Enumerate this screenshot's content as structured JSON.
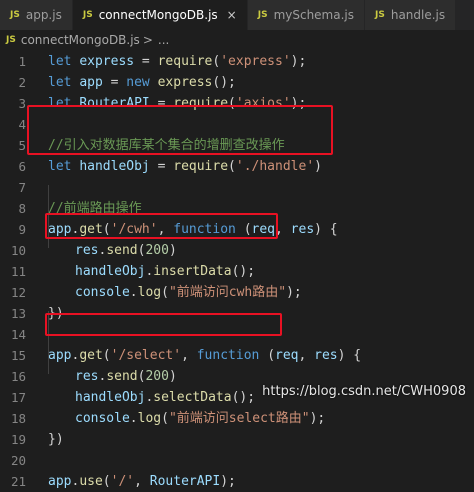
{
  "tabs": [
    {
      "icon": "JS",
      "label": "app.js",
      "active": false
    },
    {
      "icon": "JS",
      "label": "connectMongoDB.js",
      "active": true
    },
    {
      "icon": "JS",
      "label": "mySchema.js",
      "active": false
    },
    {
      "icon": "JS",
      "label": "handle.js",
      "active": false
    }
  ],
  "tab_close_glyph": "×",
  "breadcrumb": {
    "icon": "JS",
    "file": "connectMongoDB.js",
    "separator": ">",
    "more": "..."
  },
  "lines": [
    {
      "n": "1",
      "parts": [
        {
          "t": "let ",
          "c": "kw"
        },
        {
          "t": "express",
          "c": "var"
        },
        {
          "t": " = ",
          "c": "p"
        },
        {
          "t": "require",
          "c": "fn"
        },
        {
          "t": "(",
          "c": "p"
        },
        {
          "t": "'express'",
          "c": "str"
        },
        {
          "t": ");",
          "c": "p"
        }
      ]
    },
    {
      "n": "2",
      "parts": [
        {
          "t": "let ",
          "c": "kw"
        },
        {
          "t": "app",
          "c": "var"
        },
        {
          "t": " = ",
          "c": "p"
        },
        {
          "t": "new ",
          "c": "kw"
        },
        {
          "t": "express",
          "c": "fn"
        },
        {
          "t": "();",
          "c": "p"
        }
      ]
    },
    {
      "n": "3",
      "parts": [
        {
          "t": "let ",
          "c": "kw"
        },
        {
          "t": "RouterAPI",
          "c": "var"
        },
        {
          "t": " = ",
          "c": "p"
        },
        {
          "t": "require",
          "c": "fn"
        },
        {
          "t": "(",
          "c": "p"
        },
        {
          "t": "'axios'",
          "c": "str"
        },
        {
          "t": ");",
          "c": "p"
        }
      ]
    },
    {
      "n": "4",
      "parts": []
    },
    {
      "n": "5",
      "parts": [
        {
          "t": "//引入对数据库某个集合的增删查改操作",
          "c": "cmt"
        }
      ]
    },
    {
      "n": "6",
      "parts": [
        {
          "t": "let ",
          "c": "kw"
        },
        {
          "t": "handleObj",
          "c": "var"
        },
        {
          "t": " = ",
          "c": "p"
        },
        {
          "t": "require",
          "c": "fn"
        },
        {
          "t": "(",
          "c": "p"
        },
        {
          "t": "'./handle'",
          "c": "str"
        },
        {
          "t": ")",
          "c": "p"
        }
      ]
    },
    {
      "n": "7",
      "parts": []
    },
    {
      "n": "8",
      "parts": [
        {
          "t": "//前端路由操作",
          "c": "cmt"
        }
      ]
    },
    {
      "n": "9",
      "parts": [
        {
          "t": "app",
          "c": "var"
        },
        {
          "t": ".",
          "c": "p"
        },
        {
          "t": "get",
          "c": "fn"
        },
        {
          "t": "(",
          "c": "p"
        },
        {
          "t": "'/cwh'",
          "c": "str"
        },
        {
          "t": ", ",
          "c": "p"
        },
        {
          "t": "function ",
          "c": "kw"
        },
        {
          "t": "(",
          "c": "p"
        },
        {
          "t": "req",
          "c": "var"
        },
        {
          "t": ", ",
          "c": "p"
        },
        {
          "t": "res",
          "c": "var"
        },
        {
          "t": ") {",
          "c": "p"
        }
      ]
    },
    {
      "n": "10",
      "indent": true,
      "parts": [
        {
          "t": "res",
          "c": "var"
        },
        {
          "t": ".",
          "c": "p"
        },
        {
          "t": "send",
          "c": "fn"
        },
        {
          "t": "(",
          "c": "p"
        },
        {
          "t": "200",
          "c": "num"
        },
        {
          "t": ")",
          "c": "p"
        }
      ]
    },
    {
      "n": "11",
      "indent": true,
      "parts": [
        {
          "t": "handleObj",
          "c": "var"
        },
        {
          "t": ".",
          "c": "p"
        },
        {
          "t": "insertData",
          "c": "fn"
        },
        {
          "t": "();",
          "c": "p"
        }
      ]
    },
    {
      "n": "12",
      "indent": true,
      "parts": [
        {
          "t": "console",
          "c": "var"
        },
        {
          "t": ".",
          "c": "p"
        },
        {
          "t": "log",
          "c": "fn"
        },
        {
          "t": "(",
          "c": "p"
        },
        {
          "t": "\"前端访问cwh路由\"",
          "c": "str"
        },
        {
          "t": ");",
          "c": "p"
        }
      ]
    },
    {
      "n": "13",
      "parts": [
        {
          "t": "})",
          "c": "p"
        }
      ]
    },
    {
      "n": "14",
      "parts": []
    },
    {
      "n": "15",
      "parts": [
        {
          "t": "app",
          "c": "var"
        },
        {
          "t": ".",
          "c": "p"
        },
        {
          "t": "get",
          "c": "fn"
        },
        {
          "t": "(",
          "c": "p"
        },
        {
          "t": "'/select'",
          "c": "str"
        },
        {
          "t": ", ",
          "c": "p"
        },
        {
          "t": "function ",
          "c": "kw"
        },
        {
          "t": "(",
          "c": "p"
        },
        {
          "t": "req",
          "c": "var"
        },
        {
          "t": ", ",
          "c": "p"
        },
        {
          "t": "res",
          "c": "var"
        },
        {
          "t": ") {",
          "c": "p"
        }
      ]
    },
    {
      "n": "16",
      "indent": true,
      "parts": [
        {
          "t": "res",
          "c": "var"
        },
        {
          "t": ".",
          "c": "p"
        },
        {
          "t": "send",
          "c": "fn"
        },
        {
          "t": "(",
          "c": "p"
        },
        {
          "t": "200",
          "c": "num"
        },
        {
          "t": ")",
          "c": "p"
        }
      ]
    },
    {
      "n": "17",
      "indent": true,
      "parts": [
        {
          "t": "handleObj",
          "c": "var"
        },
        {
          "t": ".",
          "c": "p"
        },
        {
          "t": "selectData",
          "c": "fn"
        },
        {
          "t": "();",
          "c": "p"
        }
      ]
    },
    {
      "n": "18",
      "indent": true,
      "parts": [
        {
          "t": "console",
          "c": "var"
        },
        {
          "t": ".",
          "c": "p"
        },
        {
          "t": "log",
          "c": "fn"
        },
        {
          "t": "(",
          "c": "p"
        },
        {
          "t": "\"前端访问select路由\"",
          "c": "str"
        },
        {
          "t": ");",
          "c": "p"
        }
      ]
    },
    {
      "n": "19",
      "parts": [
        {
          "t": "})",
          "c": "p"
        }
      ]
    },
    {
      "n": "20",
      "parts": []
    },
    {
      "n": "21",
      "parts": [
        {
          "t": "app",
          "c": "var"
        },
        {
          "t": ".",
          "c": "p"
        },
        {
          "t": "use",
          "c": "fn"
        },
        {
          "t": "(",
          "c": "p"
        },
        {
          "t": "'/'",
          "c": "str"
        },
        {
          "t": ", ",
          "c": "p"
        },
        {
          "t": "RouterAPI",
          "c": "var"
        },
        {
          "t": ");",
          "c": "p"
        }
      ]
    }
  ],
  "watermark": "https://blog.csdn.net/CWH0908",
  "colors": {
    "highlight_box": "#e81123",
    "editor_bg": "#1e1e1e"
  }
}
